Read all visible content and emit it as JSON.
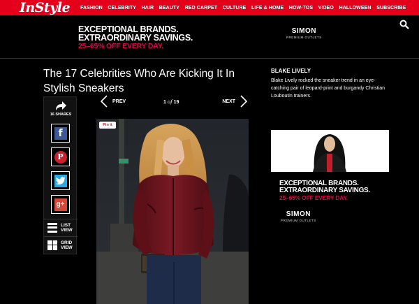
{
  "header": {
    "logo": "InStyle",
    "nav": [
      "FASHION",
      "CELEBRITY",
      "HAIR",
      "BEAUTY",
      "RED CARPET",
      "CULTURE",
      "LIFE & HOME",
      "HOW-TOS",
      "VIDEO",
      "HALLOWEEN",
      "SUBSCRIBE"
    ],
    "search_icon": "search-icon",
    "brand_color": "#e4001b"
  },
  "top_ad": {
    "line1": "EXCEPTIONAL BRANDS.",
    "line2": "EXTRAORDINARY SAVINGS.",
    "line3": "25–65% OFF EVERY DAY.",
    "brand": "SIMON",
    "brand_sub": "PREMIUM OUTLETS"
  },
  "article": {
    "title": "The 17 Celebrities Who Are Kicking It In Stylish Sneakers"
  },
  "share": {
    "count_label": "16 SHARES",
    "buttons": [
      "facebook-icon",
      "pinterest-icon",
      "twitter-icon",
      "google-plus-icon"
    ],
    "google_plus_label": "g+",
    "facebook_label": "f",
    "pinterest_label": "P",
    "list_view": "LIST VIEW",
    "grid_view": "GRID VIEW",
    "list_view_l1": "LIST",
    "list_view_l2": "VIEW",
    "grid_view_l1": "GRID",
    "grid_view_l2": "VIEW"
  },
  "pager": {
    "prev": "PREV",
    "next": "NEXT",
    "current": "1",
    "of": "of",
    "total": "19"
  },
  "photo": {
    "pin_label": "Pin it"
  },
  "caption": {
    "name": "BLAKE LIVELY",
    "text": "Blake Lively rocked the sneaker trend in an eye-catching pair of leopard-print and burgandy Christian Louboutin trainers."
  },
  "side_ad": {
    "line1": "EXCEPTIONAL BRANDS.",
    "line2": "EXTRAORDINARY SAVINGS.",
    "line3": "25–65% OFF EVERY DAY.",
    "brand": "SIMON",
    "brand_sub": "PREMIUM OUTLETS"
  }
}
